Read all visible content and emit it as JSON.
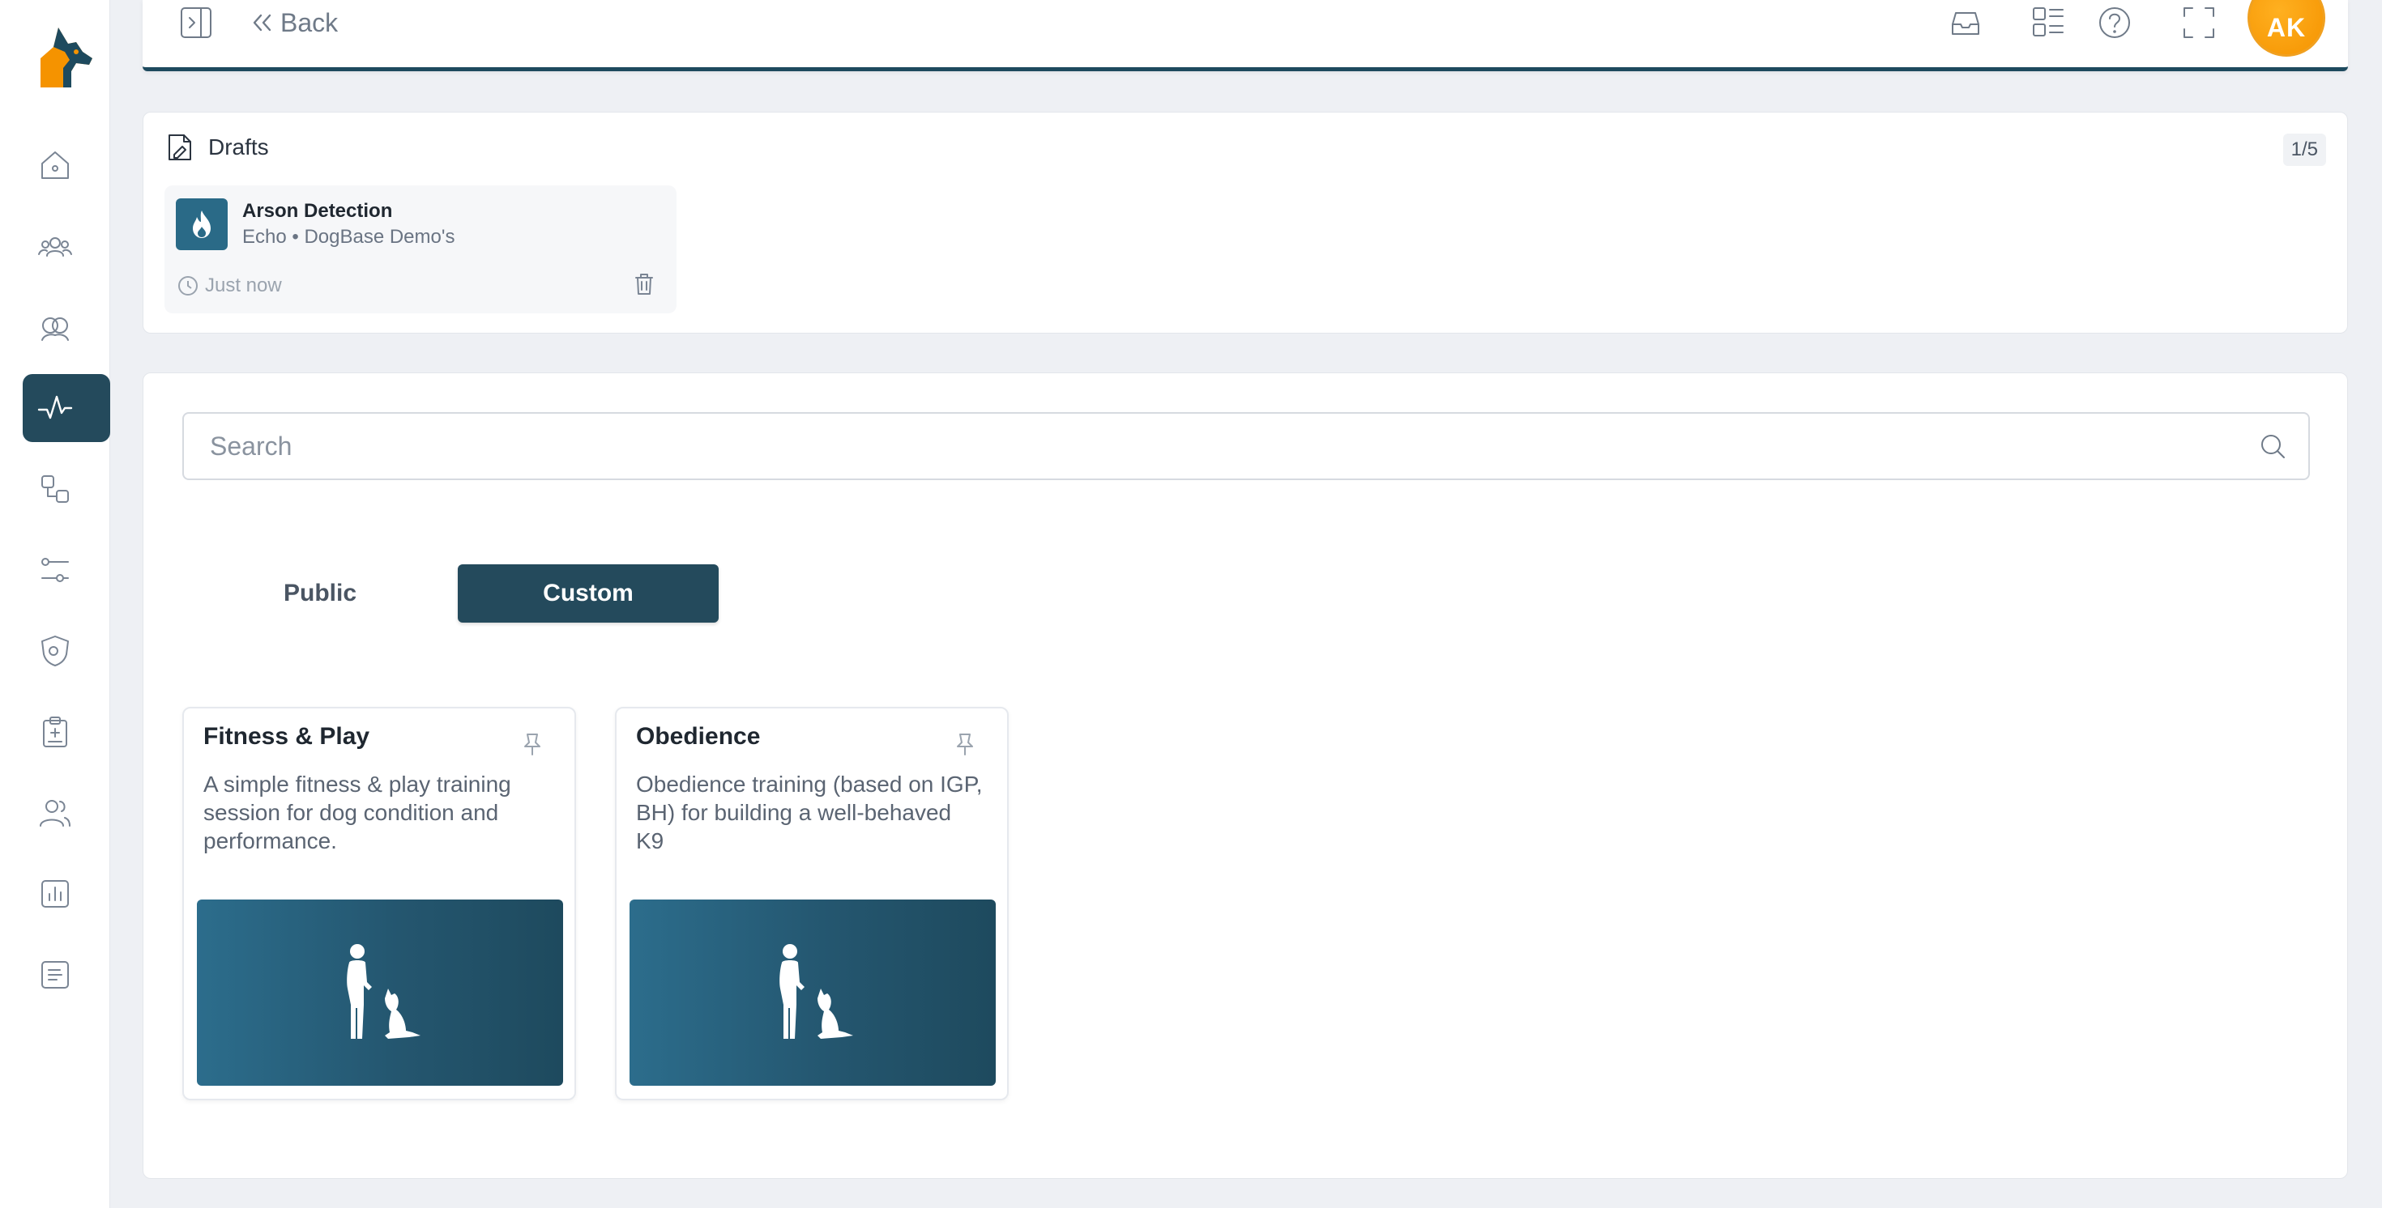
{
  "topbar": {
    "back_label": "Back",
    "avatar_initials": "AK"
  },
  "drafts": {
    "title": "Drafts",
    "count": "1/5",
    "items": [
      {
        "title": "Arson Detection",
        "subtitle": "Echo • DogBase Demo's",
        "time": "Just now"
      }
    ]
  },
  "search": {
    "placeholder": "Search"
  },
  "tabs": [
    {
      "label": "Public",
      "active": false
    },
    {
      "label": "Custom",
      "active": true
    }
  ],
  "cards": [
    {
      "title": "Fitness & Play",
      "description": "A simple fitness & play training session for dog condition and performance."
    },
    {
      "title": "Obedience",
      "description": "Obedience training (based on IGP, BH) for building a well-behaved K9"
    }
  ],
  "colors": {
    "primary": "#244a5c",
    "accent": "#f59300",
    "background": "#eef0f4"
  }
}
